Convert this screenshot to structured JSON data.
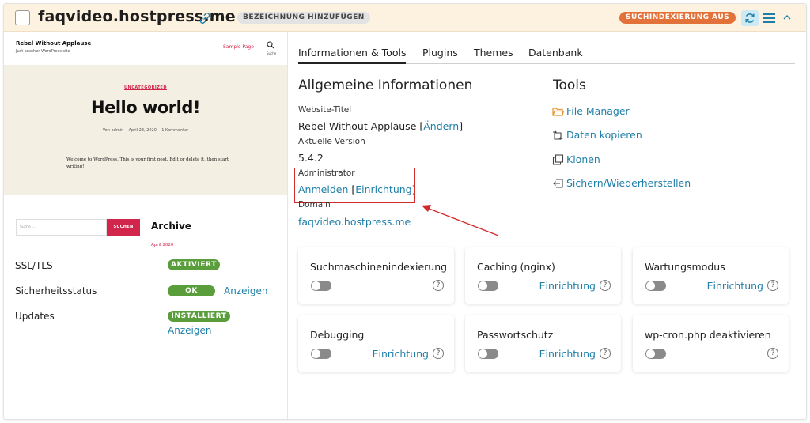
{
  "header": {
    "title": "faqvideo.hostpress.me",
    "description_badge": "BEZEICHNUNG HINZUFÜGEN",
    "indexing_badge": "SUCHINDEXIERUNG AUS"
  },
  "preview": {
    "site_name": "Rebel Without Applause",
    "tagline": "Just another WordPress site",
    "menu_item": "Sample Page",
    "search_label": "Suche",
    "category": "UNCATEGORIZED",
    "post_title": "Hello world!",
    "meta": "Von admin    April 23, 2020    1 Kommentar",
    "body": "Welcome to WordPress. This is your first post. Edit or delete it, then start writing!",
    "search_placeholder": "Suche …",
    "search_button": "SUCHEN",
    "archive_heading": "Archive",
    "archive_date": "April 2020"
  },
  "status": [
    {
      "label": "SSL/TLS",
      "badge": "AKTIVIERT",
      "link": ""
    },
    {
      "label": "Sicherheitsstatus",
      "badge": "OK",
      "link": "Anzeigen"
    },
    {
      "label": "Updates",
      "badge": "INSTALLIERT",
      "link": "Anzeigen"
    }
  ],
  "tabs": [
    "Informationen & Tools",
    "Plugins",
    "Themes",
    "Datenbank"
  ],
  "info": {
    "heading": "Allgemeine Informationen",
    "website_title_label": "Website-Titel",
    "website_title_value": "Rebel Without Applause",
    "website_title_change": "Ändern",
    "version_label": "Aktuelle Version",
    "version_value": "5.4.2",
    "admin_label": "Administrator",
    "admin_login": "Anmelden",
    "admin_setup": "Einrichtung",
    "domain_label": "Domain",
    "domain_value": "faqvideo.hostpress.me"
  },
  "tools": {
    "heading": "Tools",
    "items": [
      {
        "label": "File Manager",
        "icon": "folder-icon"
      },
      {
        "label": "Daten kopieren",
        "icon": "copy-data-icon"
      },
      {
        "label": "Klonen",
        "icon": "clone-icon"
      },
      {
        "label": "Sichern/Wiederherstellen",
        "icon": "backup-restore-icon"
      }
    ]
  },
  "cards": [
    {
      "title": "Suchmaschinenindexierung",
      "link": "",
      "enabled": false
    },
    {
      "title": "Caching (nginx)",
      "link": "Einrichtung",
      "enabled": false
    },
    {
      "title": "Wartungsmodus",
      "link": "Einrichtung",
      "enabled": false
    },
    {
      "title": "Debugging",
      "link": "Einrichtung",
      "enabled": false
    },
    {
      "title": "Passwortschutz",
      "link": "Einrichtung",
      "enabled": false
    },
    {
      "title": "wp-cron.php deaktivieren",
      "link": "",
      "enabled": false
    }
  ],
  "colors": {
    "header_bg": "#fdf1df",
    "accent_blue": "#1f7fa8",
    "status_green": "#5a9e3c",
    "index_badge": "#e2713a",
    "highlight_red": "#d12a2a",
    "wp_red": "#d1254b"
  }
}
